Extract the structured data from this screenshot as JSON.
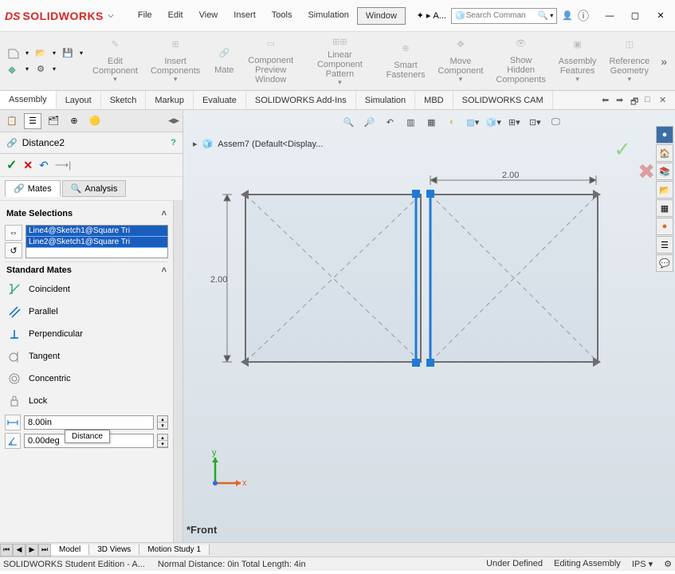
{
  "app": {
    "name": "SOLIDWORKS",
    "ds": "DS"
  },
  "menu": [
    "File",
    "Edit",
    "View",
    "Insert",
    "Tools",
    "Simulation",
    "Window"
  ],
  "star_label": "A...",
  "search_placeholder": "Search Comman",
  "ribbon": {
    "groups": [
      {
        "label": "Edit\nComponent"
      },
      {
        "label": "Insert\nComponents"
      },
      {
        "label": "Mate"
      },
      {
        "label": "Component\nPreview\nWindow"
      },
      {
        "label": "Linear Component\nPattern"
      },
      {
        "label": "Smart\nFasteners"
      },
      {
        "label": "Move\nComponent"
      },
      {
        "label": "Show\nHidden\nComponents"
      },
      {
        "label": "Assembly\nFeatures"
      },
      {
        "label": "Reference\nGeometry"
      }
    ]
  },
  "cmd_tabs": [
    "Assembly",
    "Layout",
    "Sketch",
    "Markup",
    "Evaluate",
    "SOLIDWORKS Add-Ins",
    "Simulation",
    "MBD",
    "SOLIDWORKS CAM"
  ],
  "cmd_tab_active": 0,
  "pmgr": {
    "title": "Distance2",
    "tabs": {
      "mates": "Mates",
      "analysis": "Analysis"
    },
    "section_selections": "Mate Selections",
    "selections": [
      "Line4@Sketch1@Square Tri",
      "Line2@Sketch1@Square Tri"
    ],
    "section_standard": "Standard Mates",
    "mates": [
      "Coincident",
      "Parallel",
      "Perpendicular",
      "Tangent",
      "Concentric",
      "Lock"
    ],
    "distance_value": "8.00in",
    "angle_value": "0.00deg",
    "tooltip": "Distance"
  },
  "canvas": {
    "assem": "Assem7  (Default<Display...",
    "dim1": "2.00",
    "dim2": "2.00",
    "viewlabel": "*Front",
    "axis_x": "x",
    "axis_y": "y"
  },
  "bottom_tabs": [
    "Model",
    "3D Views",
    "Motion Study 1"
  ],
  "status": {
    "left": "SOLIDWORKS Student Edition - A...",
    "mid": "Normal Distance: 0in Total Length: 4in",
    "under": "Under Defined",
    "edit": "Editing Assembly",
    "units": "IPS"
  }
}
